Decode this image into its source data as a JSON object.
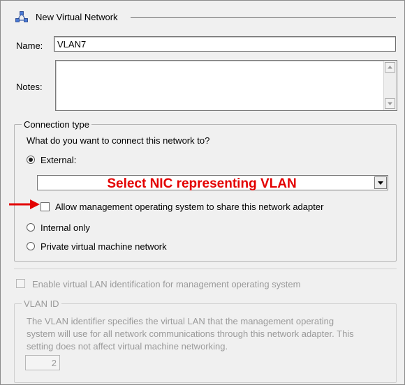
{
  "header": {
    "title": "New Virtual Network",
    "icon": "network-icon"
  },
  "name_field": {
    "label": "Name:",
    "value": "VLAN7"
  },
  "notes_field": {
    "label": "Notes:",
    "value": ""
  },
  "connection": {
    "legend": "Connection type",
    "prompt": "What do you want to connect this network to?",
    "external_label": "External:",
    "external_selected": true,
    "nic_selection": "Select NIC representing VLAN",
    "share_adapter_label": "Allow management operating system to share this network adapter",
    "share_adapter_checked": false,
    "internal_label": "Internal only",
    "private_label": "Private virtual machine network",
    "annotation_color": "#e30000"
  },
  "vlan": {
    "enable_label": "Enable virtual LAN identification for management operating system",
    "enable_checked": false,
    "legend": "VLAN ID",
    "description_line1": "The VLAN identifier specifies the virtual LAN that the management operating",
    "description_line2": "system will use for all network communications through this network adapter. This",
    "description_line3": "setting does not affect virtual machine networking.",
    "id_value": "2"
  }
}
